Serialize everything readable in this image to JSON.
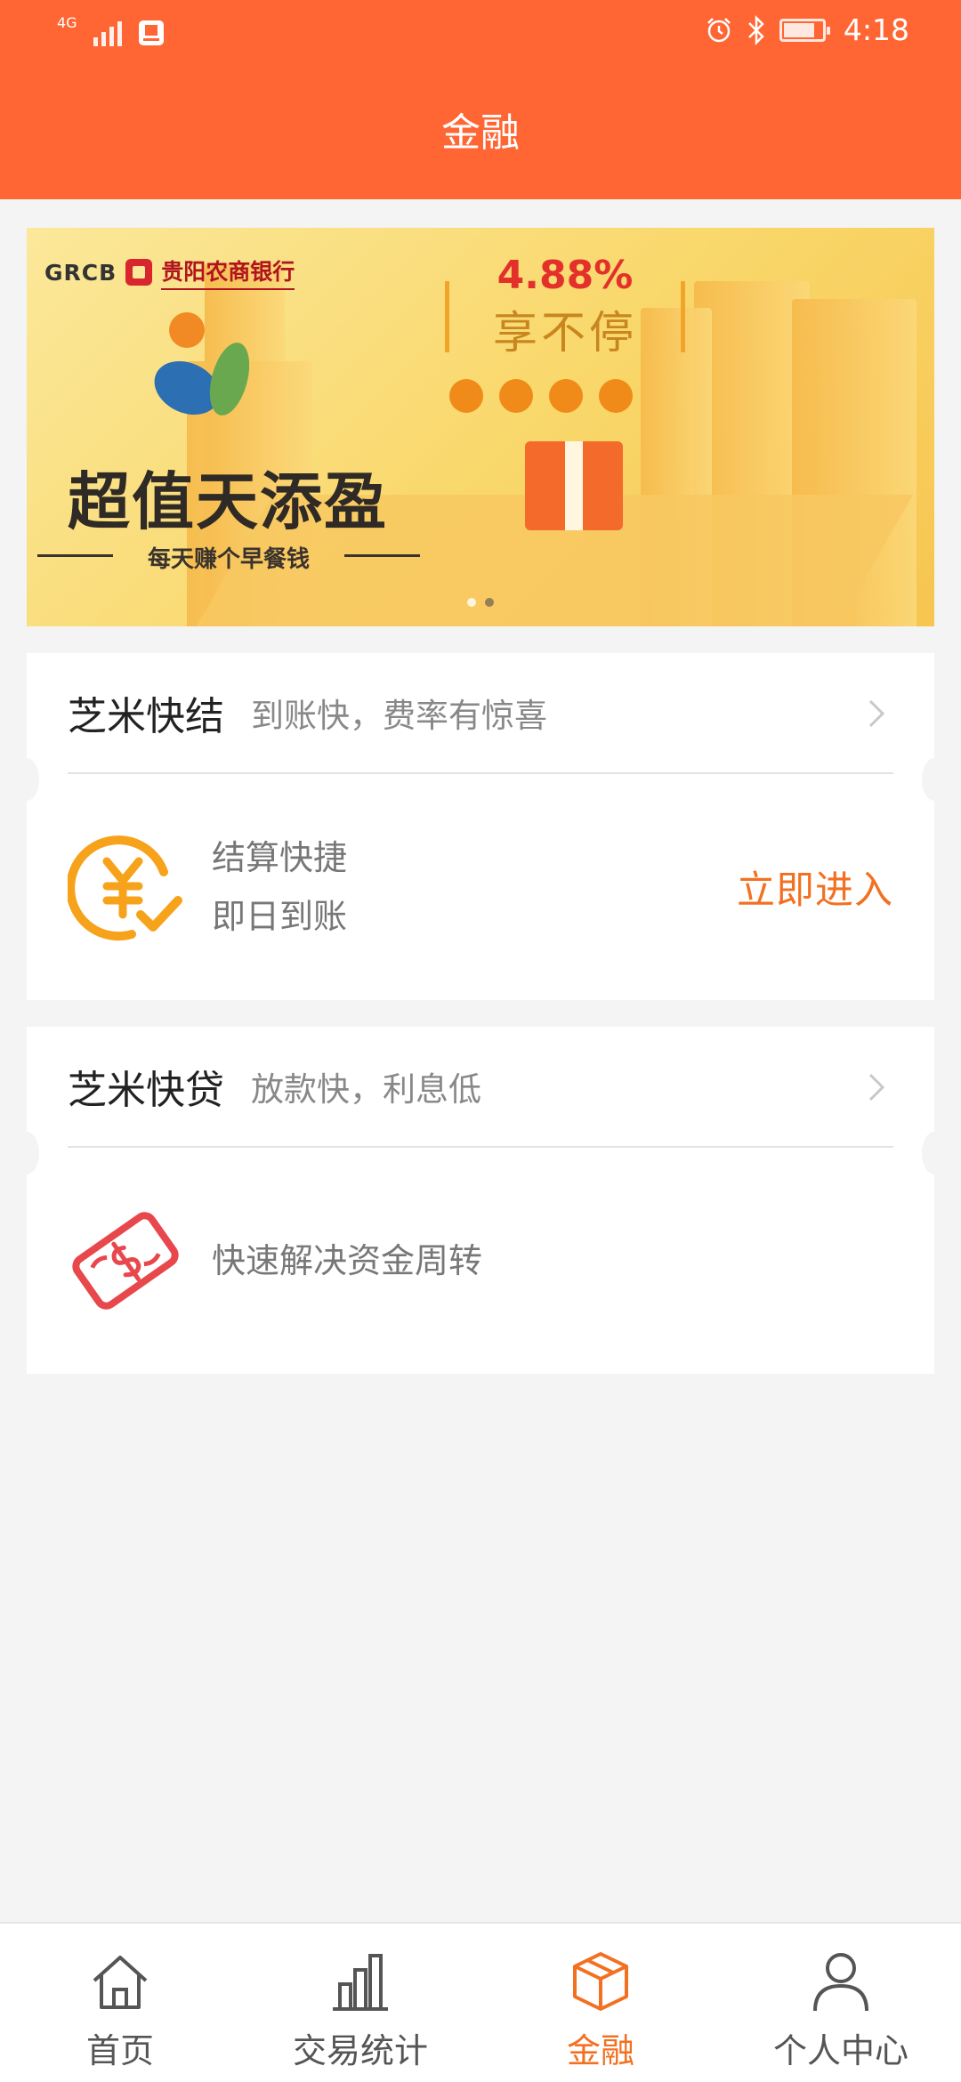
{
  "status_bar": {
    "network": "4G",
    "time": "4:18",
    "battery_level": 0.8
  },
  "header": {
    "title": "金融"
  },
  "banner": {
    "bank_code": "GRCB",
    "bank_name": "贵阳农商银行",
    "rate": "4.88%",
    "rate_caption": "享不停",
    "slogan": "超值天添盈",
    "slogan_sub": "每天赚个早餐钱",
    "page_count": 2,
    "active_page": 2
  },
  "cards": [
    {
      "title": "芝米快结",
      "subtitle": "到账快，费率有惊喜",
      "icon": "yuan-check-icon",
      "lines": [
        "结算快捷",
        "即日到账"
      ],
      "action": "立即进入"
    },
    {
      "title": "芝米快贷",
      "subtitle": "放款快，利息低",
      "icon": "money-bill-icon",
      "lines": [
        "快速解决资金周转"
      ]
    }
  ],
  "tabbar": {
    "items": [
      {
        "label": "首页",
        "icon": "home-icon"
      },
      {
        "label": "交易统计",
        "icon": "bar-chart-icon"
      },
      {
        "label": "金融",
        "icon": "box-icon",
        "active": true
      },
      {
        "label": "个人中心",
        "icon": "user-icon"
      }
    ]
  },
  "colors": {
    "brand": "#ff6633",
    "accent": "#f37021",
    "background": "#f4f4f4"
  }
}
